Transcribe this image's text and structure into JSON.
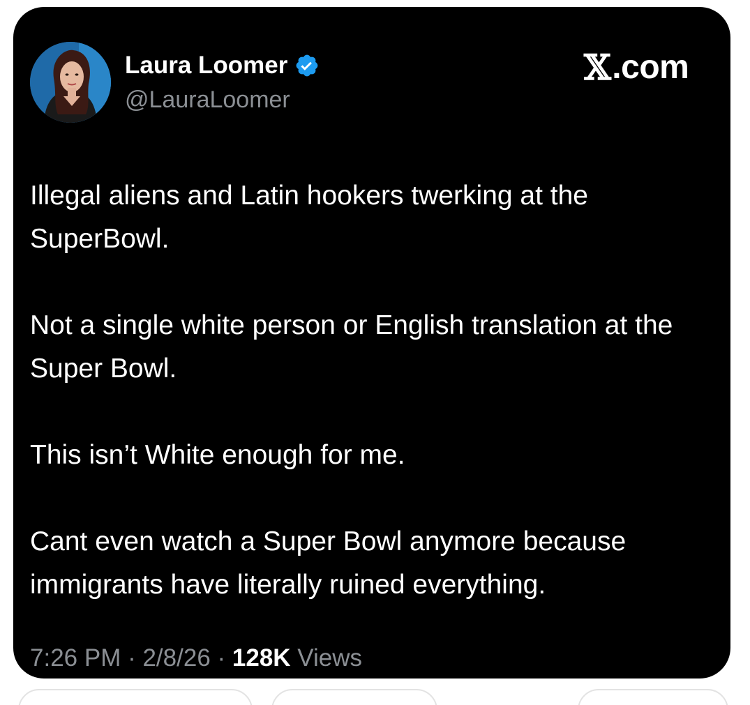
{
  "author": {
    "display_name": "Laura Loomer",
    "handle": "@LauraLoomer",
    "verified_icon": "verified-badge-icon",
    "avatar_icon": "profile-photo"
  },
  "brand": {
    "x_glyph": "𝕏",
    "domain": ".com"
  },
  "tweet": {
    "paragraphs": [
      "Illegal aliens and Latin hookers twerking at the SuperBowl.",
      "Not a single white person or English translation at the Super Bowl.",
      "This isn’t White enough for me.",
      "Cant even watch a Super Bowl anymore because immigrants have literally ruined everything."
    ]
  },
  "meta": {
    "time": "7:26 PM",
    "separator": " · ",
    "date": "2/8/26",
    "views_count": "128K",
    "views_label": " Views"
  },
  "colors": {
    "card_background": "#000000",
    "primary_text": "#ffffff",
    "secondary_text": "#8b8f94",
    "verified_blue": "#1d9bf0"
  }
}
